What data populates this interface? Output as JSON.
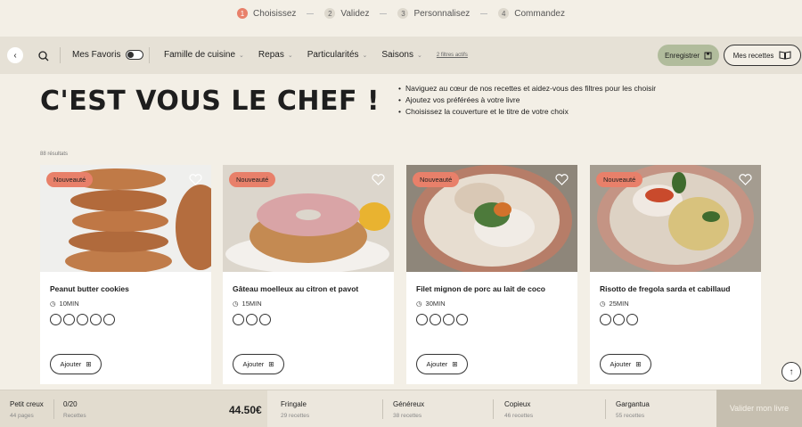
{
  "steps": [
    {
      "num": "1",
      "label": "Choisissez"
    },
    {
      "num": "2",
      "label": "Validez"
    },
    {
      "num": "3",
      "label": "Personnalisez"
    },
    {
      "num": "4",
      "label": "Commandez"
    }
  ],
  "toolbar": {
    "favorites_label": "Mes Favoris",
    "filters": [
      "Famille de cuisine",
      "Repas",
      "Particularités",
      "Saisons"
    ],
    "active_filters": "2 filtres actifs",
    "save_label": "Enregistrer",
    "my_recipes_label": "Mes recettes"
  },
  "hero": {
    "title": "C'EST VOUS LE CHEF !",
    "bullets": [
      "Naviguez au cœur de nos recettes et aidez-vous des filtres pour les choisir",
      "Ajoutez vos préférées à votre livre",
      "Choisissez la couverture et le titre de votre choix"
    ]
  },
  "results_label": "88 résultats",
  "cards": [
    {
      "badge": "Nouveauté",
      "title": "Peanut butter cookies",
      "time": "10MIN",
      "icon_count": 5,
      "add_label": "Ajouter"
    },
    {
      "badge": "Nouveauté",
      "title": "Gâteau moelleux au citron et pavot",
      "time": "15MIN",
      "icon_count": 3,
      "add_label": "Ajouter"
    },
    {
      "badge": "Nouveauté",
      "title": "Filet mignon de porc au lait de coco",
      "time": "30MIN",
      "icon_count": 4,
      "add_label": "Ajouter"
    },
    {
      "badge": "Nouveauté",
      "title": "Risotto de fregola sarda et cabillaud",
      "time": "25MIN",
      "icon_count": 3,
      "add_label": "Ajouter"
    }
  ],
  "bottom": {
    "current": {
      "name": "Petit creux",
      "pages": "44 pages"
    },
    "count": {
      "value": "0/20",
      "label": "Recettes"
    },
    "price": "44.50€",
    "options": [
      {
        "name": "Fringale",
        "recipes": "29 recettes"
      },
      {
        "name": "Généreux",
        "recipes": "38 recettes"
      },
      {
        "name": "Copieux",
        "recipes": "46 recettes"
      },
      {
        "name": "Gargantua",
        "recipes": "55 recettes"
      }
    ],
    "validate_label": "Valider mon livre"
  },
  "colors": {
    "accent": "#e8806a",
    "save_green": "#b1bc9c",
    "background": "#f3efe6"
  }
}
